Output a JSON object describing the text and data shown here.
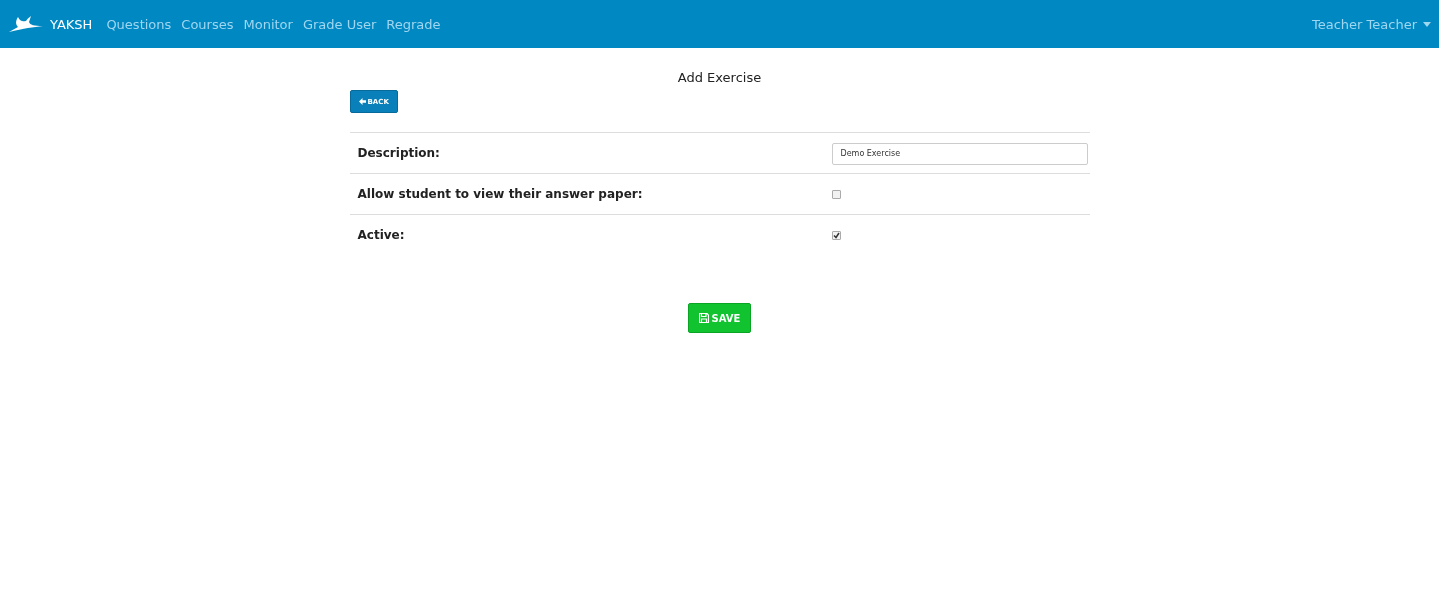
{
  "navbar": {
    "brand": "YAKSH",
    "links": [
      {
        "label": "Questions"
      },
      {
        "label": "Courses"
      },
      {
        "label": "Monitor"
      },
      {
        "label": "Grade User"
      },
      {
        "label": "Regrade"
      }
    ],
    "user_menu": "Teacher Teacher"
  },
  "title": "Add Exercise",
  "back_button": "BACK",
  "form": [
    {
      "kind": "text",
      "label": "Description:",
      "value": "Demo Exercise"
    },
    {
      "kind": "checkbox",
      "label": "Allow student to view their answer paper:",
      "checked": false
    },
    {
      "kind": "checkbox",
      "label": "Active:",
      "checked": true
    }
  ],
  "save_button": "SAVE"
}
